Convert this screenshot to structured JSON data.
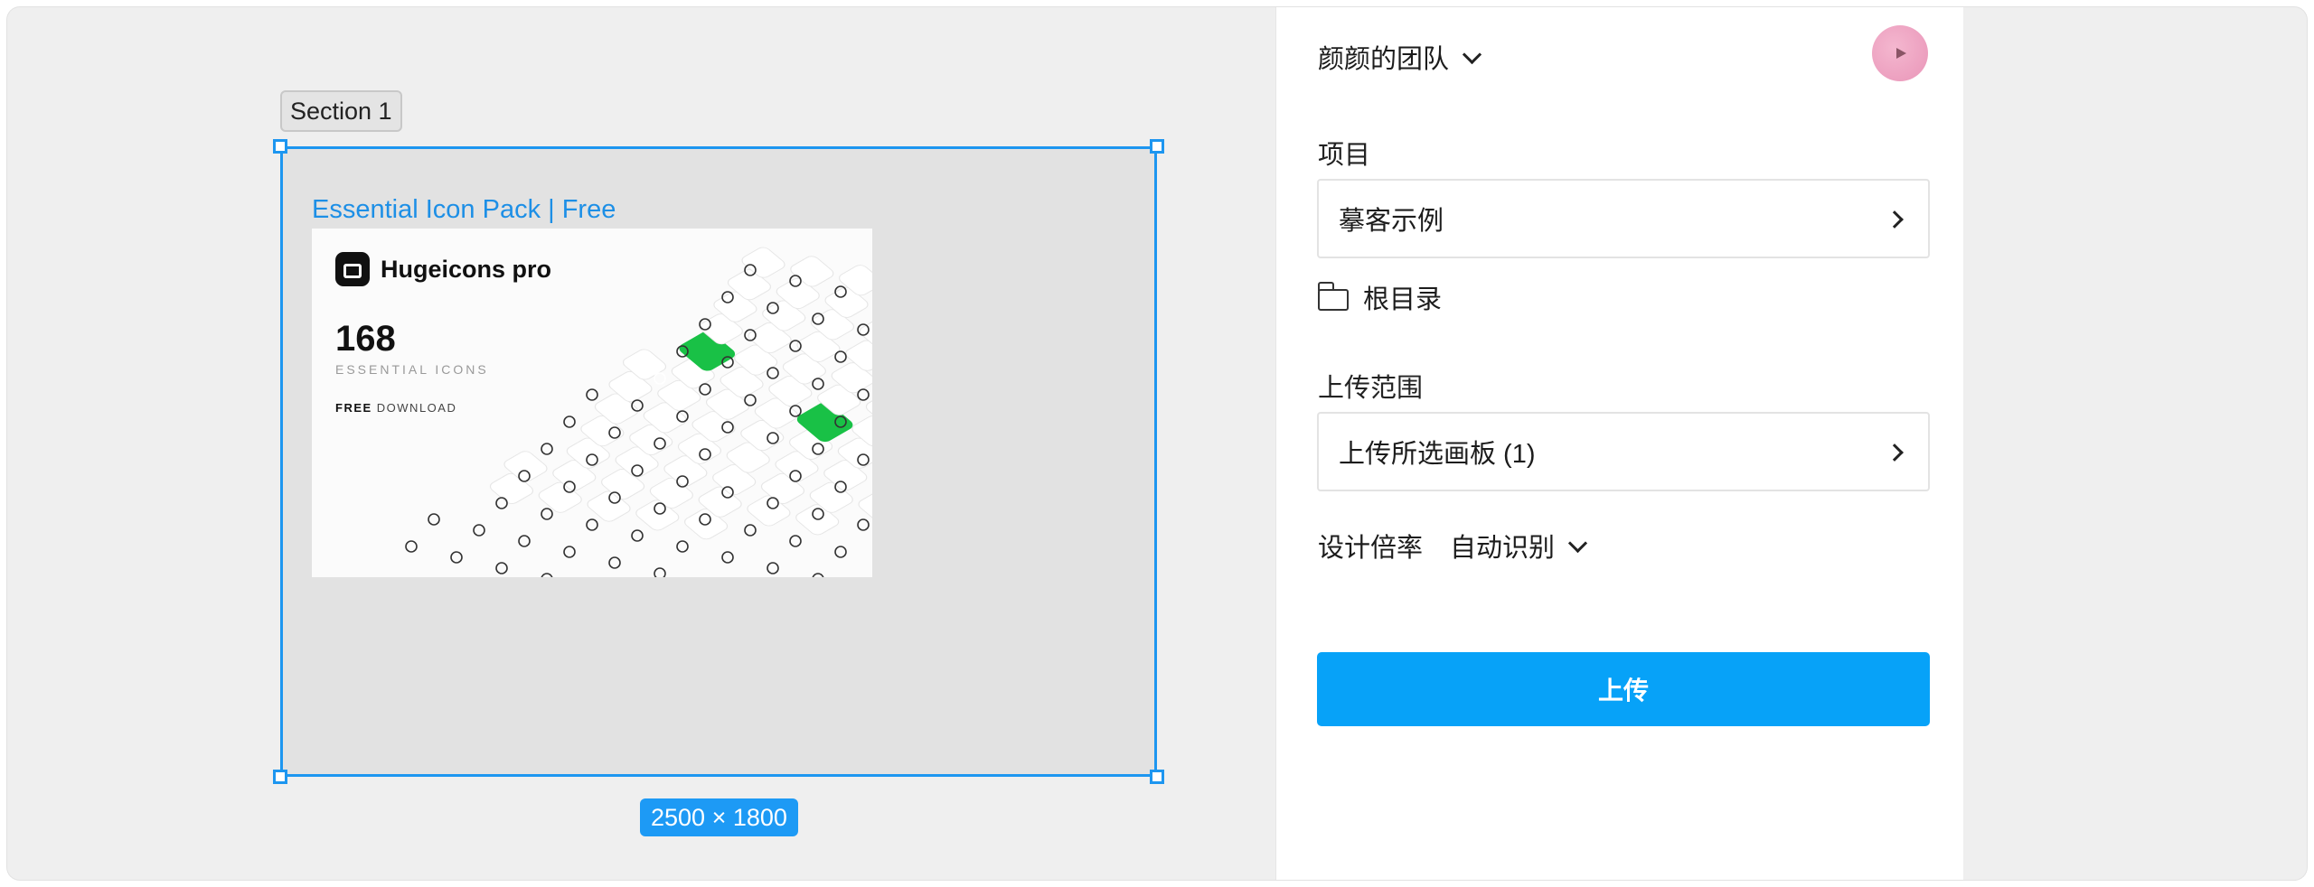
{
  "canvas": {
    "section_label": "Section 1",
    "frame_title": "Essential Icon Pack | Free",
    "thumbnail": {
      "brand_name": "Hugeicons pro",
      "count": "168",
      "count_sub": "ESSENTIAL ICONS",
      "free_bold": "FREE",
      "free_rest": " DOWNLOAD"
    },
    "size_badge": "2500 × 1800",
    "accent": "#1d96f0"
  },
  "panel": {
    "team_name": "颜颜的团队",
    "project_label": "项目",
    "project_value": "摹客示例",
    "root_label": "根目录",
    "scope_label": "上传范围",
    "scope_value": "上传所选画板 (1)",
    "ratio_label": "设计倍率",
    "ratio_value": "自动识别",
    "upload_button": "上传",
    "button_color": "#07a2f8",
    "highlight_color": "#ec3f6a"
  }
}
